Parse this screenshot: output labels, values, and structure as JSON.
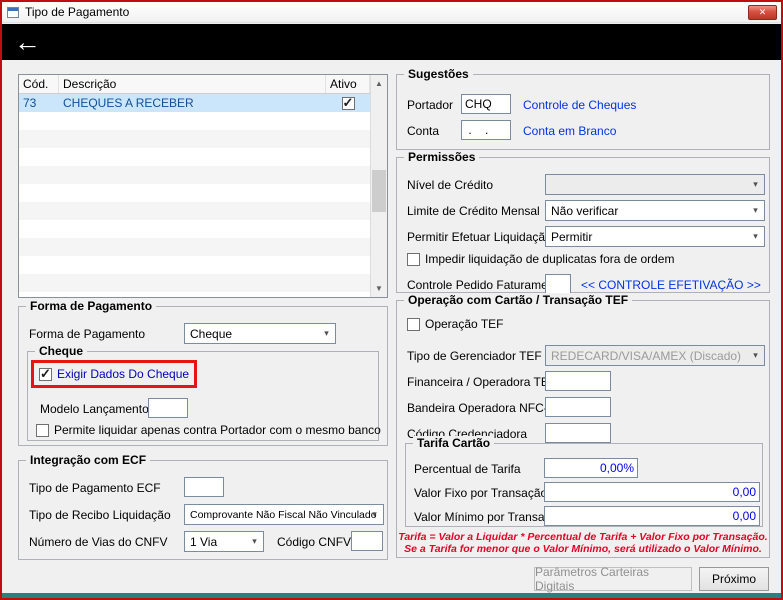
{
  "window": {
    "title": "Tipo de Pagamento",
    "icons": {
      "back": "←",
      "close": "✕",
      "scroll_up": "▲",
      "scroll_down": "▼"
    }
  },
  "grid": {
    "headers": {
      "cod": "Cód.",
      "descricao": "Descrição",
      "ativo": "Ativo"
    },
    "row": {
      "cod": "73",
      "descricao": "CHEQUES A RECEBER",
      "ativo": true
    }
  },
  "forma_pagamento": {
    "title": "Forma de Pagamento",
    "forma_label": "Forma de Pagamento",
    "forma_value": "Cheque",
    "cheque": {
      "title": "Cheque",
      "exigir_label": "Exigir Dados Do Cheque",
      "exigir_checked": true,
      "modelo_label": "Modelo Lançamento",
      "modelo_value": "",
      "permite_label": "Permite liquidar apenas contra Portador com o mesmo banco",
      "permite_checked": false
    }
  },
  "integracao_ecf": {
    "title": "Integração com ECF",
    "tipo_pagamento_label": "Tipo de Pagamento ECF",
    "tipo_pagamento_value": "",
    "tipo_recibo_label": "Tipo de Recibo Liquidação",
    "tipo_recibo_value": "Comprovante Não Fiscal Não Vinculado",
    "vias_label": "Número de Vias do CNFV",
    "vias_value": "1 Via",
    "codigo_label": "Código CNFV",
    "codigo_value": ""
  },
  "sugestoes": {
    "title": "Sugestões",
    "portador_label": "Portador",
    "portador_value": "CHQ",
    "portador_link": "Controle de Cheques",
    "conta_label": "Conta",
    "conta_value": " .    . ",
    "conta_link": "Conta em Branco"
  },
  "permissoes": {
    "title": "Permissões",
    "nivel_label": "Nível de Crédito",
    "nivel_value": "",
    "limite_label": "Limite de Crédito Mensal",
    "limite_value": "Não verificar",
    "permitir_label": "Permitir Efetuar Liquidação",
    "permitir_value": "Permitir",
    "impedir_label": "Impedir liquidação de duplicatas fora de ordem",
    "impedir_checked": false,
    "controle_label": "Controle Pedido Faturamento",
    "controle_value": "",
    "controle_link": "<< CONTROLE EFETIVAÇÃO >>"
  },
  "cartao_tef": {
    "title": "Operação com Cartão / Transação TEF",
    "operacao_label": "Operação TEF",
    "operacao_checked": false,
    "gerenciador_label": "Tipo de Gerenciador TEF",
    "gerenciador_value": "REDECARD/VISA/AMEX (Discado)",
    "financeira_label": "Financeira / Operadora TEF",
    "financeira_value": "",
    "bandeira_label": "Bandeira Operadora NFC-e",
    "bandeira_value": "",
    "credenciadora_label": "Código Credenciadora",
    "credenciadora_value": "",
    "tarifa": {
      "title": "Tarifa Cartão",
      "percentual_label": "Percentual de Tarifa",
      "percentual_value": "0,00%",
      "fixo_label": "Valor Fixo por Transação",
      "fixo_value": "0,00",
      "minimo_label": "Valor Mínimo por Transação",
      "minimo_value": "0,00"
    },
    "nota_linha1": "Tarifa = Valor a Liquidar * Percentual de Tarifa + Valor Fixo por Transação.",
    "nota_linha2": "Se a Tarifa for menor que o Valor Mínimo, será utilizado o Valor Mínimo."
  },
  "footer": {
    "parametros_button": "Parâmetros Carteiras Digitais",
    "proximo_button": "Próximo"
  }
}
